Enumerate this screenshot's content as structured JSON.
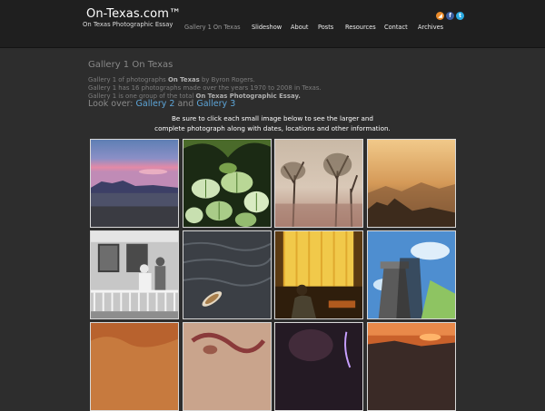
{
  "site": {
    "title": "On-Texas.com™",
    "tagline": "On Texas Photographic Essay"
  },
  "social": [
    {
      "name": "rss-icon",
      "glyph": "◢",
      "color": "#e98a2a"
    },
    {
      "name": "facebook-icon",
      "glyph": "f",
      "color": "#3b5da0"
    },
    {
      "name": "twitter-icon",
      "glyph": "t",
      "color": "#2aa9e0"
    }
  ],
  "nav": {
    "gallery1": "Gallery 1 On Texas",
    "slideshow": "Slideshow",
    "about": "About",
    "posts": "Posts",
    "resources": "Resources",
    "contact": "Contact",
    "archives": "Archives"
  },
  "page": {
    "title": "Gallery 1 On Texas",
    "line1_pre": "Gallery 1 of photographs ",
    "line1_bold": "On Texas",
    "line1_post": " by Byron Rogers.",
    "line2": "Gallery 1 has 16 photographs made over the years 1970 to 2008 in Texas.",
    "line3_pre": "Gallery 1 is one group of the total ",
    "line3_bold": "On Texas Photographic Essay.",
    "lookover": "Look over: ",
    "gallery2": "Gallery 2",
    "and": " and ",
    "gallery3": "Gallery 3",
    "instruction_line1": "Be sure to click each small image below to see the larger and",
    "instruction_line2": "complete photograph along with dates, locations and other information."
  }
}
